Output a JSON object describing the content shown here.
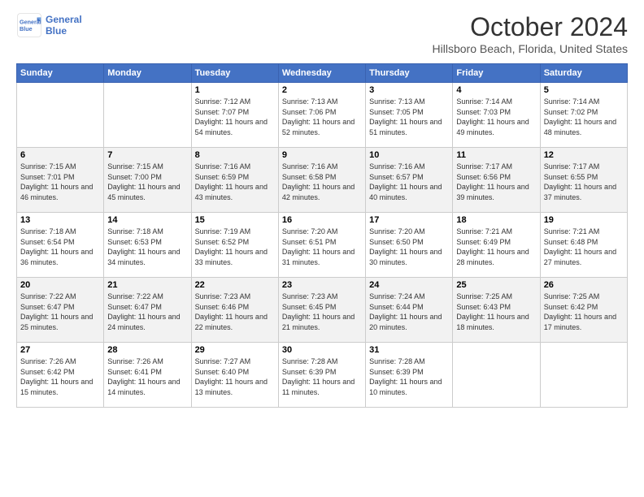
{
  "header": {
    "logo_line1": "General",
    "logo_line2": "Blue",
    "title": "October 2024",
    "location": "Hillsboro Beach, Florida, United States"
  },
  "weekdays": [
    "Sunday",
    "Monday",
    "Tuesday",
    "Wednesday",
    "Thursday",
    "Friday",
    "Saturday"
  ],
  "weeks": [
    [
      {
        "day": "",
        "sunrise": "",
        "sunset": "",
        "daylight": ""
      },
      {
        "day": "",
        "sunrise": "",
        "sunset": "",
        "daylight": ""
      },
      {
        "day": "1",
        "sunrise": "Sunrise: 7:12 AM",
        "sunset": "Sunset: 7:07 PM",
        "daylight": "Daylight: 11 hours and 54 minutes."
      },
      {
        "day": "2",
        "sunrise": "Sunrise: 7:13 AM",
        "sunset": "Sunset: 7:06 PM",
        "daylight": "Daylight: 11 hours and 52 minutes."
      },
      {
        "day": "3",
        "sunrise": "Sunrise: 7:13 AM",
        "sunset": "Sunset: 7:05 PM",
        "daylight": "Daylight: 11 hours and 51 minutes."
      },
      {
        "day": "4",
        "sunrise": "Sunrise: 7:14 AM",
        "sunset": "Sunset: 7:03 PM",
        "daylight": "Daylight: 11 hours and 49 minutes."
      },
      {
        "day": "5",
        "sunrise": "Sunrise: 7:14 AM",
        "sunset": "Sunset: 7:02 PM",
        "daylight": "Daylight: 11 hours and 48 minutes."
      }
    ],
    [
      {
        "day": "6",
        "sunrise": "Sunrise: 7:15 AM",
        "sunset": "Sunset: 7:01 PM",
        "daylight": "Daylight: 11 hours and 46 minutes."
      },
      {
        "day": "7",
        "sunrise": "Sunrise: 7:15 AM",
        "sunset": "Sunset: 7:00 PM",
        "daylight": "Daylight: 11 hours and 45 minutes."
      },
      {
        "day": "8",
        "sunrise": "Sunrise: 7:16 AM",
        "sunset": "Sunset: 6:59 PM",
        "daylight": "Daylight: 11 hours and 43 minutes."
      },
      {
        "day": "9",
        "sunrise": "Sunrise: 7:16 AM",
        "sunset": "Sunset: 6:58 PM",
        "daylight": "Daylight: 11 hours and 42 minutes."
      },
      {
        "day": "10",
        "sunrise": "Sunrise: 7:16 AM",
        "sunset": "Sunset: 6:57 PM",
        "daylight": "Daylight: 11 hours and 40 minutes."
      },
      {
        "day": "11",
        "sunrise": "Sunrise: 7:17 AM",
        "sunset": "Sunset: 6:56 PM",
        "daylight": "Daylight: 11 hours and 39 minutes."
      },
      {
        "day": "12",
        "sunrise": "Sunrise: 7:17 AM",
        "sunset": "Sunset: 6:55 PM",
        "daylight": "Daylight: 11 hours and 37 minutes."
      }
    ],
    [
      {
        "day": "13",
        "sunrise": "Sunrise: 7:18 AM",
        "sunset": "Sunset: 6:54 PM",
        "daylight": "Daylight: 11 hours and 36 minutes."
      },
      {
        "day": "14",
        "sunrise": "Sunrise: 7:18 AM",
        "sunset": "Sunset: 6:53 PM",
        "daylight": "Daylight: 11 hours and 34 minutes."
      },
      {
        "day": "15",
        "sunrise": "Sunrise: 7:19 AM",
        "sunset": "Sunset: 6:52 PM",
        "daylight": "Daylight: 11 hours and 33 minutes."
      },
      {
        "day": "16",
        "sunrise": "Sunrise: 7:20 AM",
        "sunset": "Sunset: 6:51 PM",
        "daylight": "Daylight: 11 hours and 31 minutes."
      },
      {
        "day": "17",
        "sunrise": "Sunrise: 7:20 AM",
        "sunset": "Sunset: 6:50 PM",
        "daylight": "Daylight: 11 hours and 30 minutes."
      },
      {
        "day": "18",
        "sunrise": "Sunrise: 7:21 AM",
        "sunset": "Sunset: 6:49 PM",
        "daylight": "Daylight: 11 hours and 28 minutes."
      },
      {
        "day": "19",
        "sunrise": "Sunrise: 7:21 AM",
        "sunset": "Sunset: 6:48 PM",
        "daylight": "Daylight: 11 hours and 27 minutes."
      }
    ],
    [
      {
        "day": "20",
        "sunrise": "Sunrise: 7:22 AM",
        "sunset": "Sunset: 6:47 PM",
        "daylight": "Daylight: 11 hours and 25 minutes."
      },
      {
        "day": "21",
        "sunrise": "Sunrise: 7:22 AM",
        "sunset": "Sunset: 6:47 PM",
        "daylight": "Daylight: 11 hours and 24 minutes."
      },
      {
        "day": "22",
        "sunrise": "Sunrise: 7:23 AM",
        "sunset": "Sunset: 6:46 PM",
        "daylight": "Daylight: 11 hours and 22 minutes."
      },
      {
        "day": "23",
        "sunrise": "Sunrise: 7:23 AM",
        "sunset": "Sunset: 6:45 PM",
        "daylight": "Daylight: 11 hours and 21 minutes."
      },
      {
        "day": "24",
        "sunrise": "Sunrise: 7:24 AM",
        "sunset": "Sunset: 6:44 PM",
        "daylight": "Daylight: 11 hours and 20 minutes."
      },
      {
        "day": "25",
        "sunrise": "Sunrise: 7:25 AM",
        "sunset": "Sunset: 6:43 PM",
        "daylight": "Daylight: 11 hours and 18 minutes."
      },
      {
        "day": "26",
        "sunrise": "Sunrise: 7:25 AM",
        "sunset": "Sunset: 6:42 PM",
        "daylight": "Daylight: 11 hours and 17 minutes."
      }
    ],
    [
      {
        "day": "27",
        "sunrise": "Sunrise: 7:26 AM",
        "sunset": "Sunset: 6:42 PM",
        "daylight": "Daylight: 11 hours and 15 minutes."
      },
      {
        "day": "28",
        "sunrise": "Sunrise: 7:26 AM",
        "sunset": "Sunset: 6:41 PM",
        "daylight": "Daylight: 11 hours and 14 minutes."
      },
      {
        "day": "29",
        "sunrise": "Sunrise: 7:27 AM",
        "sunset": "Sunset: 6:40 PM",
        "daylight": "Daylight: 11 hours and 13 minutes."
      },
      {
        "day": "30",
        "sunrise": "Sunrise: 7:28 AM",
        "sunset": "Sunset: 6:39 PM",
        "daylight": "Daylight: 11 hours and 11 minutes."
      },
      {
        "day": "31",
        "sunrise": "Sunrise: 7:28 AM",
        "sunset": "Sunset: 6:39 PM",
        "daylight": "Daylight: 11 hours and 10 minutes."
      },
      {
        "day": "",
        "sunrise": "",
        "sunset": "",
        "daylight": ""
      },
      {
        "day": "",
        "sunrise": "",
        "sunset": "",
        "daylight": ""
      }
    ]
  ]
}
